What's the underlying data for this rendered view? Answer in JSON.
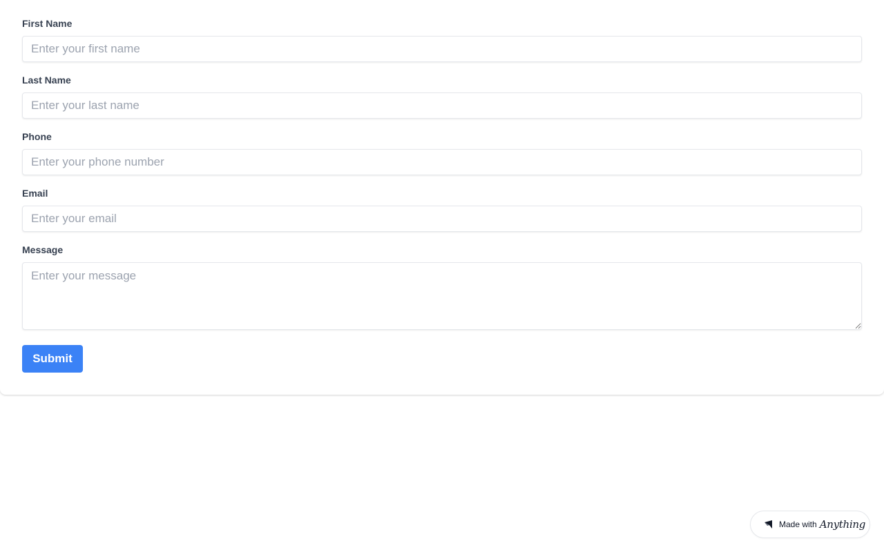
{
  "form": {
    "fields": [
      {
        "label": "First Name",
        "placeholder": "Enter your first name",
        "value": ""
      },
      {
        "label": "Last Name",
        "placeholder": "Enter your last name",
        "value": ""
      },
      {
        "label": "Phone",
        "placeholder": "Enter your phone number",
        "value": ""
      },
      {
        "label": "Email",
        "placeholder": "Enter your email",
        "value": ""
      }
    ],
    "message": {
      "label": "Message",
      "placeholder": "Enter your message",
      "value": ""
    },
    "submit_label": "Submit"
  },
  "badge": {
    "text": "Made with",
    "brand": "Anything",
    "icon": "anything-logo-icon"
  },
  "colors": {
    "accent": "#3b82f6",
    "label": "#374151",
    "placeholder": "#9ca3af",
    "border": "#e5e7eb"
  }
}
